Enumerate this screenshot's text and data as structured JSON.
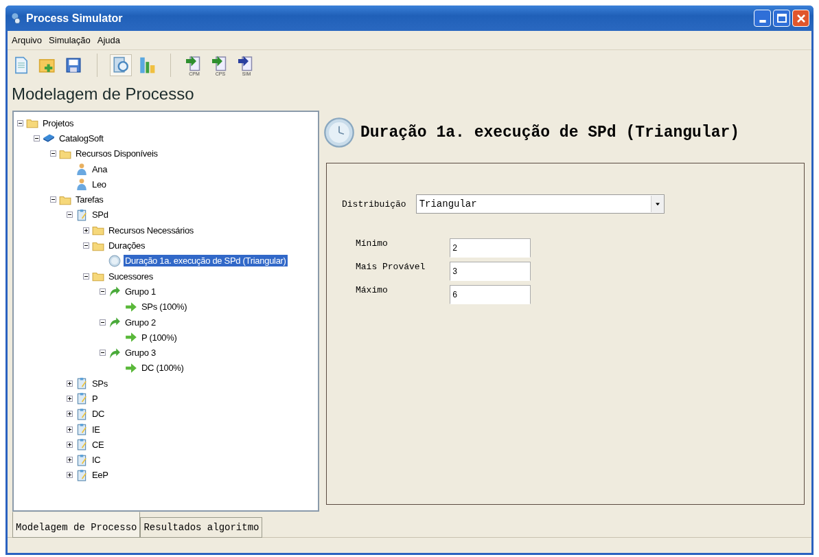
{
  "window": {
    "title": "Process Simulator"
  },
  "menu": [
    "Arquivo",
    "Simulação",
    "Ajuda"
  ],
  "toolbar": [
    [
      {
        "kind": "new"
      },
      {
        "kind": "open"
      },
      {
        "kind": "save"
      }
    ],
    [
      {
        "kind": "inspect",
        "pressed": true
      },
      {
        "kind": "chart",
        "pressed": false
      }
    ],
    [
      {
        "kind": "export",
        "label": "CPM",
        "color": "#2f8f2f"
      },
      {
        "kind": "export",
        "label": "CPS",
        "color": "#2f8f2f"
      },
      {
        "kind": "export",
        "label": "SIM",
        "color": "#2a3f9f"
      }
    ]
  ],
  "page_title": "Modelagem de Processo",
  "tree": [
    {
      "kind": "folder",
      "label": "Projetos",
      "expanded": true,
      "selected": false,
      "children": [
        {
          "kind": "project",
          "label": "CatalogSoft",
          "expanded": true,
          "selected": false,
          "children": [
            {
              "kind": "folder",
              "label": "Recursos Disponíveis",
              "expanded": true,
              "selected": false,
              "children": [
                {
                  "kind": "person",
                  "label": "Ana",
                  "selected": false
                },
                {
                  "kind": "person",
                  "label": "Leo",
                  "selected": false
                }
              ]
            },
            {
              "kind": "folder",
              "label": "Tarefas",
              "expanded": true,
              "selected": false,
              "children": [
                {
                  "kind": "task",
                  "label": "SPd",
                  "expanded": true,
                  "selected": false,
                  "children": [
                    {
                      "kind": "folder",
                      "label": "Recursos Necessários",
                      "expanded": false,
                      "selected": false
                    },
                    {
                      "kind": "folder",
                      "label": "Durações",
                      "expanded": true,
                      "selected": false,
                      "children": [
                        {
                          "kind": "clock",
                          "label": "Duração 1a. execução de SPd (Triangular)",
                          "selected": true
                        }
                      ]
                    },
                    {
                      "kind": "folder",
                      "label": "Sucessores",
                      "expanded": true,
                      "selected": false,
                      "children": [
                        {
                          "kind": "group",
                          "label": "Grupo 1",
                          "expanded": true,
                          "selected": false,
                          "children": [
                            {
                              "kind": "arrow",
                              "label": "SPs (100%)",
                              "selected": false
                            }
                          ]
                        },
                        {
                          "kind": "group",
                          "label": "Grupo 2",
                          "expanded": true,
                          "selected": false,
                          "children": [
                            {
                              "kind": "arrow",
                              "label": "P (100%)",
                              "selected": false
                            }
                          ]
                        },
                        {
                          "kind": "group",
                          "label": "Grupo 3",
                          "expanded": true,
                          "selected": false,
                          "children": [
                            {
                              "kind": "arrow",
                              "label": "DC (100%)",
                              "selected": false
                            }
                          ]
                        }
                      ]
                    }
                  ]
                },
                {
                  "kind": "task",
                  "label": "SPs",
                  "expanded": false,
                  "selected": false
                },
                {
                  "kind": "task",
                  "label": "P",
                  "expanded": false,
                  "selected": false
                },
                {
                  "kind": "task",
                  "label": "DC",
                  "expanded": false,
                  "selected": false
                },
                {
                  "kind": "task",
                  "label": "IE",
                  "expanded": false,
                  "selected": false
                },
                {
                  "kind": "task",
                  "label": "CE",
                  "expanded": false,
                  "selected": false
                },
                {
                  "kind": "task",
                  "label": "IC",
                  "expanded": false,
                  "selected": false
                },
                {
                  "kind": "task",
                  "label": "EeP",
                  "expanded": false,
                  "selected": false
                }
              ]
            }
          ]
        }
      ]
    }
  ],
  "detail": {
    "title": "Duração 1a. execução de SPd (Triangular)",
    "distribution": {
      "label": "Distribuição",
      "value": "Triangular"
    },
    "params": [
      {
        "label": "Mínimo",
        "value": "2"
      },
      {
        "label": "Mais Provável",
        "value": "3"
      },
      {
        "label": "Máximo",
        "value": "6"
      }
    ]
  },
  "tabs": [
    {
      "label": "Modelagem de Processo",
      "selected": true
    },
    {
      "label": "Resultados algoritmo",
      "selected": false
    }
  ]
}
